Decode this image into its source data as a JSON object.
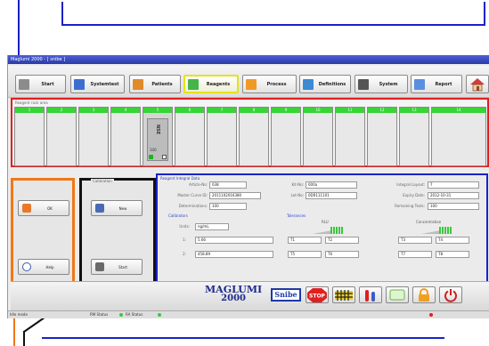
{
  "window": {
    "title": "Maglumi 2000 - [ snibe ]"
  },
  "toolbar": {
    "start": "Start",
    "systemtest": "Systemtest",
    "patients": "Patients",
    "reagents": "Reagents",
    "process": "Process",
    "definitions": "Definitions",
    "system": "System",
    "report": "Report"
  },
  "rack": {
    "label": "Reagent rack area",
    "slots": [
      "1",
      "2",
      "3",
      "4",
      "5",
      "6",
      "7",
      "8",
      "9",
      "10",
      "11",
      "12",
      "13",
      "14"
    ],
    "reagent": {
      "name": "NSE",
      "count": "100"
    }
  },
  "ok_panel": {
    "ok": "OK",
    "help": "Help"
  },
  "calibration": {
    "title": "Calibration",
    "new": "New",
    "start": "Start"
  },
  "detail": {
    "title": "Reagent Integral Data",
    "article_label": "Article-No:",
    "article": "038",
    "kit_label": "Kit-No:",
    "kit": "000a",
    "layout_label": "Integral Layout:",
    "layout": "7",
    "curve_label": "Master Curve ID:",
    "curve": "2011102016380",
    "lot_label": "Lot-No:",
    "lot": "0DR111101",
    "expiry_label": "Expiry Date:",
    "expiry": "2012-10-31",
    "determ_label": "Determinations:",
    "determ": "100",
    "remaining_label": "Remaining Tests:",
    "remaining": "100",
    "calibrators": "Calibrators",
    "units_label": "Units:",
    "units": "ng/mL",
    "c1_label": "1:",
    "c1": "5.66",
    "c2_label": "2:",
    "c2": "458.89",
    "tolerances": "Tolerances",
    "rlu": "RLU",
    "concentration": "Concentration",
    "t1": "T1",
    "t2": "T2",
    "t3": "T3",
    "t4": "T4",
    "t5": "T5",
    "t6": "T6",
    "t7": "T7",
    "t8": "T8"
  },
  "bottom": {
    "brand_1": "MAGLUMI",
    "brand_2": "2000",
    "snibe": "Snibe",
    "stop": "STOP"
  },
  "status": {
    "left": "Idle mode",
    "mid": "RM Status",
    "right": "RA Status"
  }
}
